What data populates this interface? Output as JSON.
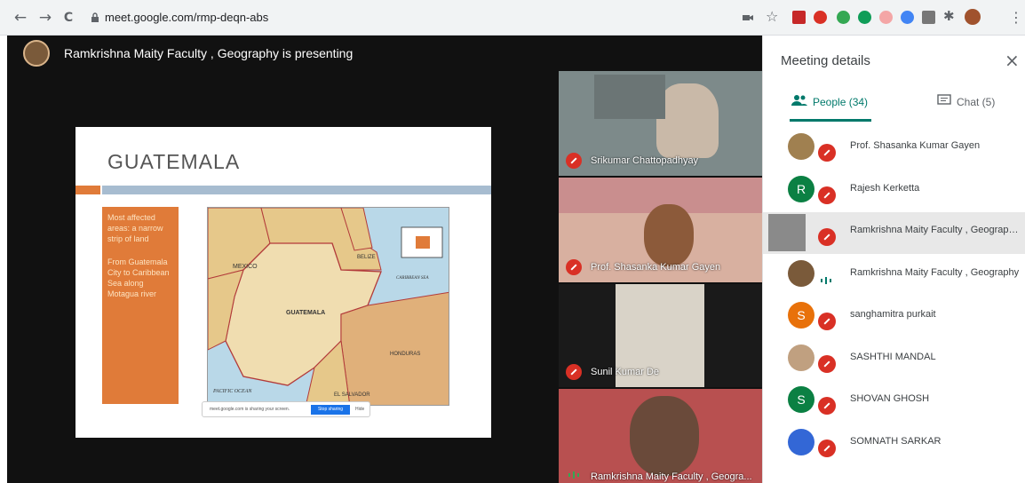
{
  "browser": {
    "url": "meet.google.com/rmp-deqn-abs",
    "nav": {
      "back": "←",
      "forward": "→",
      "reload": "C"
    }
  },
  "stage": {
    "presenter_text": "Ramkrishna Maity Faculty , Geography is presenting",
    "slide": {
      "title": "GUATEMALA",
      "box_line1": "Most affected areas: a narrow strip of land",
      "box_line2": "From Guatemala City to Caribbean Sea along Motagua river",
      "map_labels": {
        "mexico": "MEXICO",
        "belize": "BELIZE",
        "guatemala": "GUATEMALA",
        "honduras": "HONDURAS",
        "salvador": "EL SALVADOR",
        "pacific": "PACIFIC OCEAN",
        "caribbean": "CARIBBEAN SEA"
      },
      "share_text": "meet.google.com is sharing your screen.",
      "share_stop": "Stop sharing",
      "share_hide": "Hide"
    },
    "tiles": [
      {
        "name": "Srikumar Chattopadhyay"
      },
      {
        "name": "Prof. Shasanka Kumar Gayen"
      },
      {
        "name": "Sunil Kumar De"
      },
      {
        "name": "Ramkrishna Maity Faculty , Geogra..."
      }
    ]
  },
  "panel": {
    "title": "Meeting details",
    "close_icon": "×",
    "tab_people": "People (34)",
    "tab_chat": "Chat (5)",
    "people": [
      {
        "name": "Prof. Shasanka Kumar Gayen",
        "initial": "",
        "color": "#a08050"
      },
      {
        "name": "Rajesh Kerketta",
        "initial": "R",
        "color": "#0b8043"
      },
      {
        "name": "Ramkrishna Maity Faculty , Geograph...",
        "initial": "",
        "color": "#8a8a8a"
      },
      {
        "name": "Ramkrishna Maity Faculty , Geography",
        "initial": "",
        "color": "#7a5a3a"
      },
      {
        "name": "sanghamitra purkait",
        "initial": "S",
        "color": "#e8710a"
      },
      {
        "name": "SASHTHI MANDAL",
        "initial": "",
        "color": "#c0a080"
      },
      {
        "name": "SHOVAN GHOSH",
        "initial": "S",
        "color": "#0b8043"
      },
      {
        "name": "SOMNATH SARKAR",
        "initial": "",
        "color": "#3367d6"
      }
    ]
  },
  "colors": {
    "accent": "#00796b",
    "mute": "#d93025",
    "slide_orange": "#e07b39"
  }
}
